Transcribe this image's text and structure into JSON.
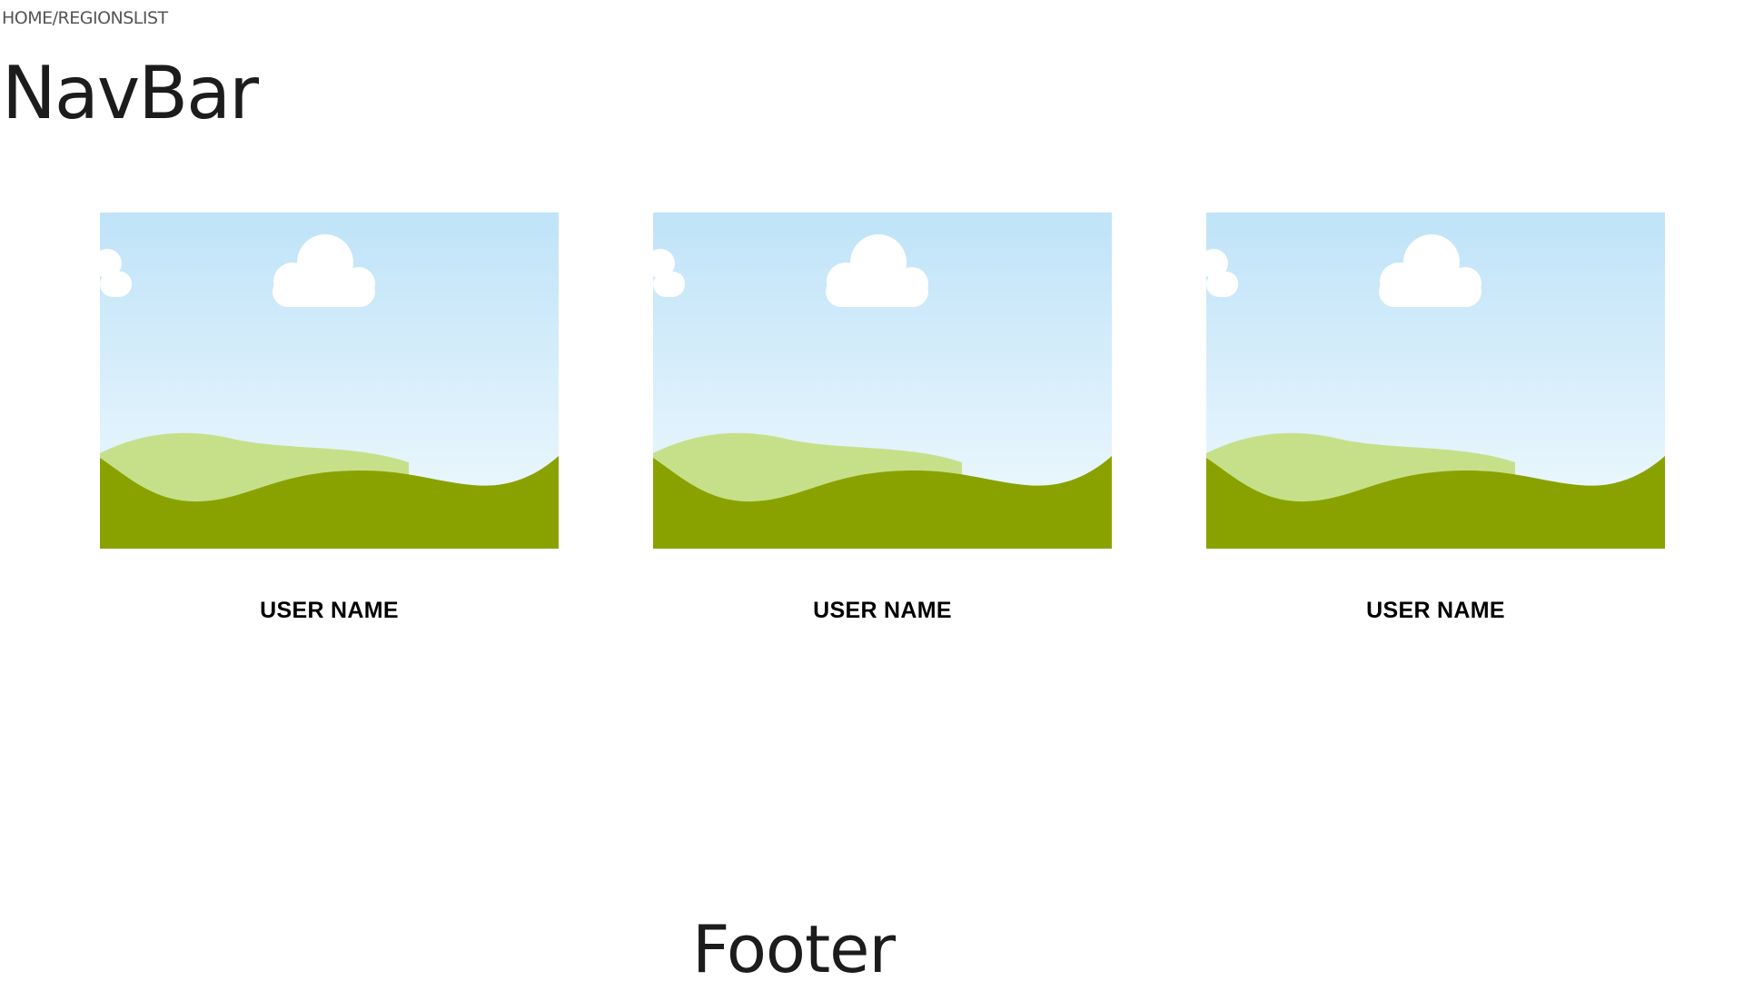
{
  "breadcrumb": {
    "text": "HOME/REGIONSLIST"
  },
  "navbar": {
    "title": "NavBar"
  },
  "cards": [
    {
      "image_icon": "landscape-placeholder-image",
      "name": "USER NAME"
    },
    {
      "image_icon": "landscape-placeholder-image",
      "name": "USER NAME"
    },
    {
      "image_icon": "landscape-placeholder-image",
      "name": "USER NAME"
    }
  ],
  "footer": {
    "title": "Footer"
  },
  "colors": {
    "sky_top": "#bfe3f8",
    "sky_bottom": "#eef8fd",
    "cloud": "#ffffff",
    "hill_light": "#c6e08a",
    "hill_dark": "#8aa200"
  }
}
